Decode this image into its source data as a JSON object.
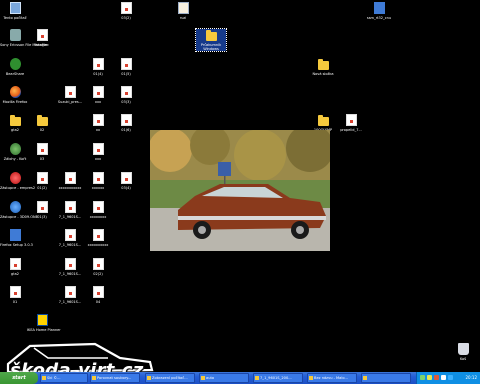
{
  "desktop_icons": [
    {
      "label": "Tento počítač",
      "icon": "computer"
    },
    {
      "label": "Sony Ericsson File Manager",
      "icon": "sony-ericsson-icon"
    },
    {
      "label": "BearShare",
      "icon": "bearshare-icon"
    },
    {
      "label": "Mozilla Firefox",
      "icon": "firefox-icon"
    },
    {
      "label": "gta2",
      "icon": "folder"
    },
    {
      "label": "Zálohy - Kořt",
      "icon": "backup-icon"
    },
    {
      "label": "Zástupce - empres2",
      "icon": "opera-icon"
    },
    {
      "label": "Zástupce - 3D09.ONE",
      "icon": "ie-icon"
    },
    {
      "label": "Firefox Setup 3.0.3",
      "icon": "setup-icon"
    },
    {
      "label": "gta2",
      "icon": "document"
    },
    {
      "label": "01",
      "icon": "document"
    },
    {
      "label": "fotoFlec",
      "icon": "document"
    },
    {
      "label": "02",
      "icon": "folder"
    },
    {
      "label": "03",
      "icon": "document"
    },
    {
      "label": "01(2)",
      "icon": "document"
    },
    {
      "label": "01(3)",
      "icon": "document"
    },
    {
      "label": "IKEA Home Planner",
      "icon": "ikea-icon"
    },
    {
      "label": "Suzuki_pres...",
      "icon": "document"
    },
    {
      "label": "xxxxxxxxxxx",
      "icon": "document"
    },
    {
      "label": "7_1_9601S...",
      "icon": "document"
    },
    {
      "label": "7_1_9601S...",
      "icon": "document"
    },
    {
      "label": "7_1_9601S...",
      "icon": "document"
    },
    {
      "label": "7_1_9601S...",
      "icon": "document"
    },
    {
      "label": "01(4)",
      "icon": "document"
    },
    {
      "label": "xxx",
      "icon": "document"
    },
    {
      "label": "xx",
      "icon": "document"
    },
    {
      "label": "xxx",
      "icon": "document"
    },
    {
      "label": "xxxxxx",
      "icon": "document"
    },
    {
      "label": "xxxxxxxx",
      "icon": "document"
    },
    {
      "label": "xxxxxxxxxx",
      "icon": "document"
    },
    {
      "label": "02(2)",
      "icon": "document"
    },
    {
      "label": "04",
      "icon": "document"
    },
    {
      "label": "03(2)",
      "icon": "document"
    },
    {
      "label": "01(5)",
      "icon": "document"
    },
    {
      "label": "03(3)",
      "icon": "document"
    },
    {
      "label": "01(6)",
      "icon": "document"
    },
    {
      "label": "03(4)",
      "icon": "document"
    },
    {
      "label": "ruzi",
      "icon": "mail-icon"
    },
    {
      "label": "Průzkumník Windows",
      "icon": "explorer-icon"
    },
    {
      "label": "Nová složka",
      "icon": "folder"
    },
    {
      "label": "100OLYMP",
      "icon": "folder"
    },
    {
      "label": "propelid_7...",
      "icon": "document"
    },
    {
      "label": "ssm_rt32_cnu",
      "icon": "setup-icon"
    },
    {
      "label": "Koš",
      "icon": "trash-icon"
    }
  ],
  "watermark": {
    "text": "škoda.virt.cz"
  },
  "taskbar": {
    "start_label": "start",
    "buttons": [
      {
        "label": "Ski ©..."
      },
      {
        "label": "Porovnat soubory..."
      },
      {
        "label": "Zobrazení počítač..."
      },
      {
        "label": "auto"
      },
      {
        "label": "7_1_9601S_200..."
      },
      {
        "label": "Bez názvu - Malo..."
      }
    ],
    "clock": "20:12"
  },
  "colors": {
    "desktop": "#000000",
    "taskbar": "#245ed6",
    "start": "#3a9632",
    "tray": "#0f8fe4"
  }
}
